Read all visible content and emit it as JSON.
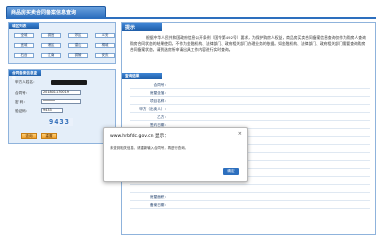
{
  "top_tab": {
    "title": "商品房买卖合同备案信息查询"
  },
  "left": {
    "district_title": "城区列表",
    "districts": [
      "全城",
      "铜官",
      "郊区",
      "义安",
      "宜城",
      "港区",
      "潜山",
      "桐城",
      "石台",
      "江南",
      "铜陵",
      "安庆"
    ],
    "query_title": "合同备案信息查询",
    "contract_label": "甲方人姓名：",
    "number_label": "合同号：",
    "number_value": "201801170019",
    "password_label": "密  码：",
    "password_value": "••••••",
    "captcha_label": "验证码：",
    "captcha_input": "9433",
    "captcha_image": "9433",
    "query_button": "查询",
    "reset_button": "重置"
  },
  "right": {
    "notice_title": "提示",
    "notice_text": "根据中华人民共和国政府信息公开条例（国令第492号）要求，为保护购房人权益，商品房买卖合同备案信息查询仅作为购房人查询购房合同状态的结果使用，不作为金融机构、法律部门、政府相关部门办理业务的依据。如金融机构、法律部门、政府相关部门需要查询购房合同备案状态，请到选房所申请出具工作内容进行实时查询。",
    "result_title": "查询结果",
    "fields": [
      "合同号：",
      "房屋坐落：",
      "项目名称：",
      "甲方（出卖人）：",
      "乙方：",
      "签约日期：",
      "",
      "",
      "",
      "",
      "",
      "",
      "",
      "",
      "房屋面积：",
      "备案日期："
    ]
  },
  "dialog": {
    "title": "www.hrbfdc.gov.cn 显示：",
    "message": "未查到相关信息，请重新输入合同号，再进行查询。",
    "ok": "确定"
  }
}
